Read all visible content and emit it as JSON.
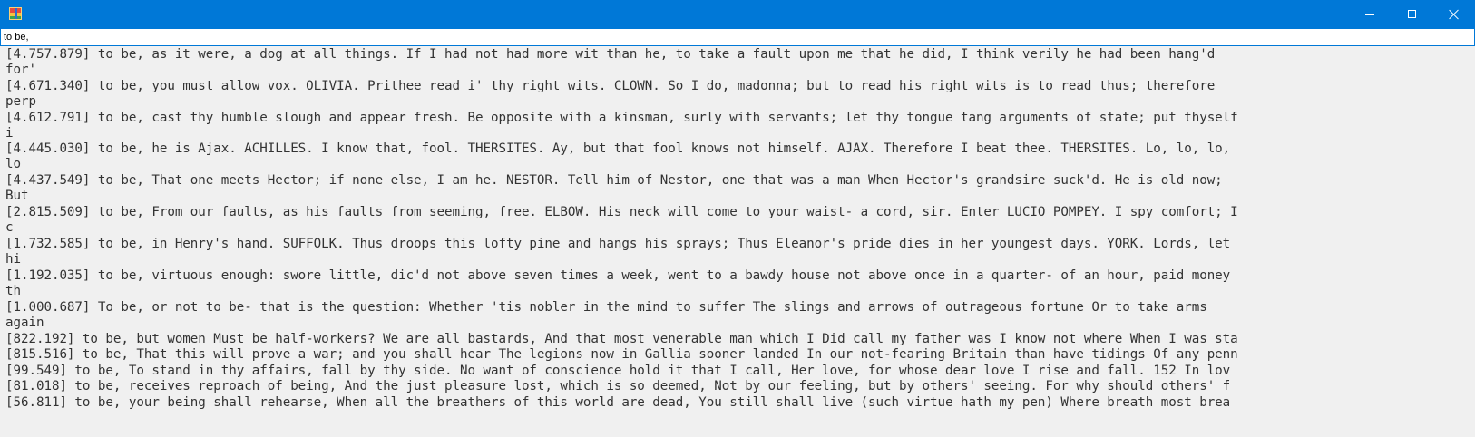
{
  "window": {
    "icons": {
      "app": "application-icon",
      "minimize": "minimize-icon",
      "maximize": "maximize-icon",
      "close": "close-icon"
    }
  },
  "search": {
    "value": "to be,"
  },
  "results": [
    "[4.757.879] to be, as it were, a dog at all things. If I had not had more wit than he, to take a fault upon me that he did, I think verily he had been hang'd",
    "for'",
    "[4.671.340] to be, you must allow vox. OLIVIA. Prithee read i' thy right wits. CLOWN. So I do, madonna; but to read his right wits is to read thus; therefore",
    "perp",
    "[4.612.791] to be, cast thy humble slough and appear fresh. Be opposite with a kinsman, surly with servants; let thy tongue tang arguments of state; put thyself",
    "i",
    "[4.445.030] to be, he is Ajax. ACHILLES. I know that, fool. THERSITES. Ay, but that fool knows not himself. AJAX. Therefore I beat thee. THERSITES. Lo, lo, lo,",
    "lo",
    "[4.437.549] to be, That one meets Hector; if none else, I am he. NESTOR. Tell him of Nestor, one that was a man When Hector's grandsire suck'd. He is old now;",
    "But",
    "[2.815.509] to be, From our faults, as his faults from seeming, free. ELBOW. His neck will come to your waist- a cord, sir. Enter LUCIO POMPEY. I spy comfort; I",
    "c",
    "[1.732.585] to be, in Henry's hand. SUFFOLK. Thus droops this lofty pine and hangs his sprays; Thus Eleanor's pride dies in her youngest days. YORK. Lords, let",
    "hi",
    "[1.192.035] to be, virtuous enough: swore little, dic'd not above seven times a week, went to a bawdy house not above once in a quarter- of an hour, paid money",
    "th",
    "[1.000.687] To be, or not to be- that is the question: Whether 'tis nobler in the mind to suffer The slings and arrows of outrageous fortune Or to take arms",
    "again",
    "[822.192] to be, but women Must be half-workers? We are all bastards, And that most venerable man which I Did call my father was I know not where When I was sta",
    "[815.516] to be, That this will prove a war; and you shall hear The legions now in Gallia sooner landed In our not-fearing Britain than have tidings Of any penn",
    "[99.549] to be, To stand in thy affairs, fall by thy side. No want of conscience hold it that I call, Her love, for whose dear love I rise and fall. 152 In lov",
    "[81.018] to be, receives reproach of being, And the just pleasure lost, which is so deemed, Not by our feeling, but by others' seeing. For why should others' f",
    "[56.811] to be, your being shall rehearse, When all the breathers of this world are dead, You still shall live (such virtue hath my pen) Where breath most brea"
  ]
}
